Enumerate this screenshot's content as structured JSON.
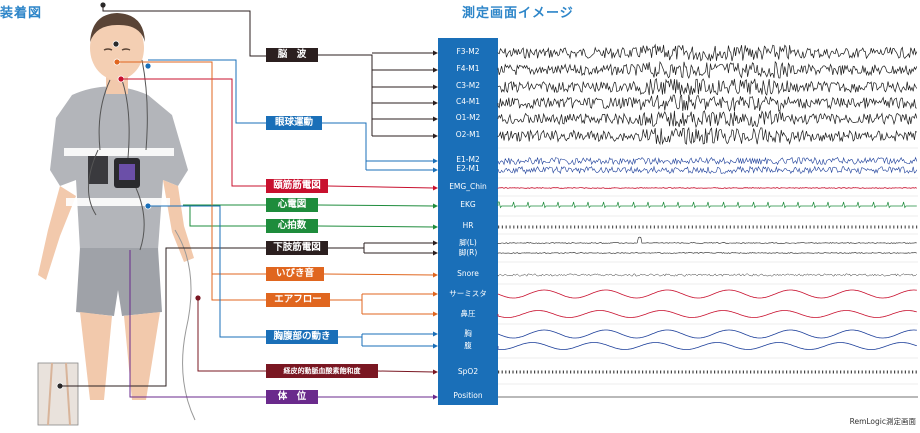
{
  "header": {
    "left_title": "装着図",
    "right_title": "測定画面イメージ"
  },
  "colors": {
    "panel_blue": "#1a6fb8",
    "eeg_black": "#1a1a1a",
    "eog_blue": "#1d3f9a",
    "emg_red": "#c8102e",
    "ekg_green": "#1e8c3c",
    "orange": "#e0661f",
    "purple": "#6a2a8c",
    "dark_red": "#7a1722",
    "label_dark": "#2b1f1f"
  },
  "categories": [
    {
      "id": "eeg",
      "label": "脳　波",
      "color": "#2b1f1f"
    },
    {
      "id": "eog",
      "label": "眼球運動",
      "color": "#1a6fb8"
    },
    {
      "id": "chin-emg",
      "label": "頤筋筋電図",
      "color": "#c8102e"
    },
    {
      "id": "ecg",
      "label": "心電図",
      "color": "#1e8c3c"
    },
    {
      "id": "heart-rate",
      "label": "心拍数",
      "color": "#1e8c3c"
    },
    {
      "id": "leg-emg",
      "label": "下肢筋電図",
      "color": "#2b1f1f"
    },
    {
      "id": "snore",
      "label": "いびき音",
      "color": "#e0661f"
    },
    {
      "id": "airflow",
      "label": "エアフロー",
      "color": "#e0661f"
    },
    {
      "id": "chest-abdomen",
      "label": "胸腹部の動き",
      "color": "#1a6fb8"
    },
    {
      "id": "spo2",
      "label": "経皮的動脈血酸素飽和度",
      "color": "#7a1722"
    },
    {
      "id": "position",
      "label": "体　位",
      "color": "#6a2a8c"
    }
  ],
  "channels": [
    "F3-M2",
    "F4-M1",
    "C3-M2",
    "C4-M1",
    "O1-M2",
    "O2-M1",
    "E1-M2",
    "E2-M1",
    "EMG_Chin",
    "EKG",
    "HR",
    "脚(L)",
    "脚(R)",
    "Snore",
    "サーミスタ",
    "鼻圧",
    "胸",
    "腹",
    "SpO2",
    "Position"
  ],
  "caption": "RemLogic測定画面"
}
